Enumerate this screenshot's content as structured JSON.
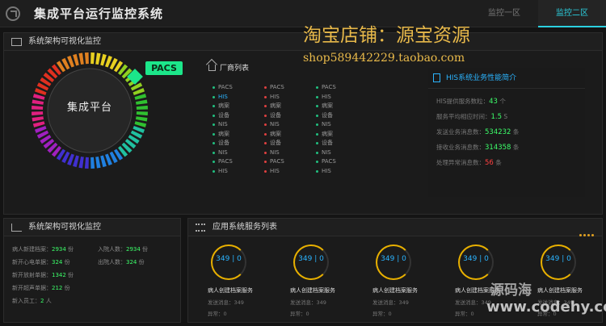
{
  "header": {
    "title": "集成平台运行监控系统",
    "tabs": [
      {
        "label": "监控一区"
      },
      {
        "label": "监控二区"
      }
    ]
  },
  "architecture_panel": {
    "title": "系统架构可视化监控",
    "center_label": "集成平台",
    "active_tag": "PACS",
    "ring_colors": [
      "#e8d020",
      "#90d020",
      "#30c030",
      "#20c0a0",
      "#2080e0",
      "#4030d0",
      "#a020c0",
      "#e02080",
      "#e03020",
      "#e08020"
    ]
  },
  "vendor_list": {
    "title": "厂商列表",
    "columns": [
      [
        "PACS",
        "HIS",
        "病案",
        "设备",
        "NIS",
        "病案",
        "设备",
        "NIS",
        "PACS",
        "HIS"
      ],
      [
        "PACS",
        "HIS",
        "病案",
        "设备",
        "NIS",
        "病案",
        "设备",
        "NIS",
        "PACS",
        "HIS"
      ],
      [
        "PACS",
        "HIS",
        "病案",
        "设备",
        "NIS",
        "病案",
        "设备",
        "NIS",
        "PACS",
        "HIS"
      ]
    ],
    "dot_colors": [
      "#20c080",
      "#e04040",
      "#20c080"
    ]
  },
  "his_performance": {
    "title": "HIS系统业务性能简介",
    "rows": [
      {
        "label": "HIS提供服务数粒：",
        "value": "43",
        "unit": "个",
        "tone": "g"
      },
      {
        "label": "服务平均相应时间：",
        "value": "1.5",
        "unit": "S",
        "tone": "g"
      },
      {
        "label": "发送业务消息数：",
        "value": "534232",
        "unit": "条",
        "tone": "g"
      },
      {
        "label": "接收业务消息数：",
        "value": "314358",
        "unit": "条",
        "tone": "g"
      },
      {
        "label": "处理异常消息数：",
        "value": "56",
        "unit": "条",
        "tone": "r"
      }
    ]
  },
  "stats_panel": {
    "title": "系统架构可视化监控",
    "rows": [
      {
        "l1": "病人新建档案：",
        "v1": "2934",
        "u1": "份",
        "l2": "入院人数：",
        "v2": "2934",
        "u2": "份"
      },
      {
        "l1": "新开心电单据：",
        "v1": "324",
        "u1": "份",
        "l2": "出院人数：",
        "v2": "324",
        "u2": "份"
      },
      {
        "l1": "新开放射单据：",
        "v1": "1342",
        "u1": "份",
        "l2": "",
        "v2": "",
        "u2": ""
      },
      {
        "l1": "新开超声单据：",
        "v1": "212",
        "u1": "份",
        "l2": "",
        "v2": "",
        "u2": ""
      },
      {
        "l1": "新入员工：",
        "v1": "2",
        "u1": "人",
        "l2": "",
        "v2": "",
        "u2": ""
      }
    ]
  },
  "services_panel": {
    "title": "应用系统服务列表",
    "services": [
      {
        "gauge": "349 | 0",
        "name": "病人创建档案服务",
        "sent": "发送消息：349",
        "error": "异常：0"
      },
      {
        "gauge": "349 | 0",
        "name": "病人创建档案服务",
        "sent": "发送消息：349",
        "error": "异常：0"
      },
      {
        "gauge": "349 | 0",
        "name": "病人创建档案服务",
        "sent": "发送消息：349",
        "error": "异常：0"
      },
      {
        "gauge": "349 | 0",
        "name": "病人创建档案服务",
        "sent": "发送消息：349",
        "error": "异常：0"
      },
      {
        "gauge": "349 | 0",
        "name": "病人创建档案服务",
        "sent": "发送消息：349",
        "error": "异常：0"
      }
    ]
  },
  "watermarks": {
    "shop_name": "淘宝店铺：源宝资源",
    "shop_url": "shop589442229.taobao.com",
    "site_cn": "源码海",
    "site_url": "www.codehy.com"
  }
}
